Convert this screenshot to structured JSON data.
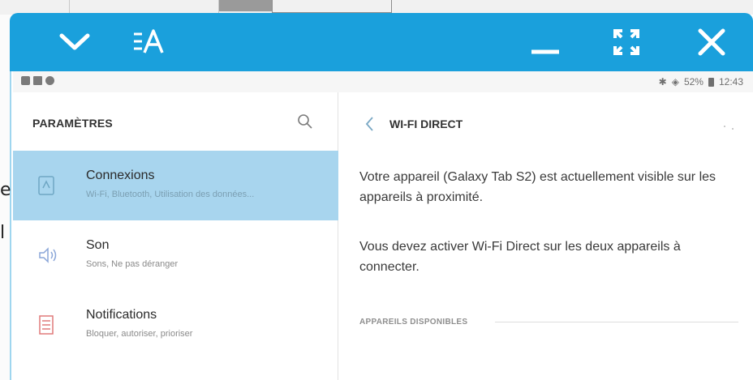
{
  "window": {
    "title_icon": "text-size-icon",
    "controls": [
      "chevron-down-icon",
      "minimize-icon",
      "fullscreen-icon",
      "close-icon"
    ],
    "accent_color": "#1aa0dc"
  },
  "statusbar": {
    "left_icons": [
      "photo-icon",
      "mail-icon",
      "sync-icon"
    ],
    "bluetooth_icon": "bluetooth-icon",
    "wifi_icon": "wifi-icon",
    "battery": "52%",
    "battery_icon": "battery-icon",
    "time": "12:43"
  },
  "sidebar": {
    "title": "PARAMÈTRES",
    "search_icon": "search-icon",
    "items": [
      {
        "title": "Connexions",
        "subtitle": "Wi-Fi, Bluetooth, Utilisation des données...",
        "icon": "connections-icon",
        "selected": true
      },
      {
        "title": "Son",
        "subtitle": "Sons, Ne pas déranger",
        "icon": "sound-icon",
        "selected": false
      },
      {
        "title": "Notifications",
        "subtitle": "Bloquer, autoriser, prioriser",
        "icon": "notifications-icon",
        "selected": false
      }
    ]
  },
  "detail": {
    "title": "WI-FI DIRECT",
    "back_icon": "back-icon",
    "paragraph1": "Votre appareil (Galaxy Tab S2) est actuellement visible sur les appareils à proximité.",
    "paragraph2": "Vous devez activer Wi-Fi Direct sur les deux appareils à connecter.",
    "section_label": "APPAREILS DISPONIBLES"
  }
}
